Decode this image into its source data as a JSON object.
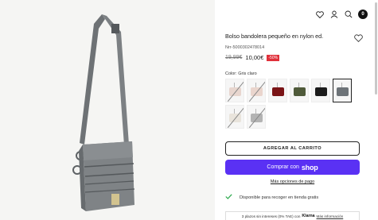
{
  "header": {
    "icons": [
      "heart-icon",
      "user-icon",
      "search-icon",
      "bag-icon"
    ],
    "cart_count": "0"
  },
  "product": {
    "title": "Bolso bandolera pequeño en nylon ed.",
    "sku": "Nrr-5000302478014",
    "old_price": "19,99€",
    "price": "10,00€",
    "discount": "-50%"
  },
  "color": {
    "label": "Color:",
    "value": "Gris claro",
    "swatches": [
      {
        "color": "#e8d6cf",
        "available": false
      },
      {
        "color": "#ead5cd",
        "available": false
      },
      {
        "color": "#7a1416",
        "available": true
      },
      {
        "color": "#4f5a3a",
        "available": true
      },
      {
        "color": "#1b1b1b",
        "available": true
      },
      {
        "color": "#6d7378",
        "available": true,
        "selected": true
      },
      {
        "color": "#e9e4dc",
        "available": false
      },
      {
        "color": "#b3b3b3",
        "available": false
      }
    ]
  },
  "actions": {
    "add_to_cart": "AGREGAR AL CARRITO",
    "buy_with": "Comprar con",
    "buy_brand": "shop",
    "more_options": "Más opciones de pago"
  },
  "availability": {
    "text": "Disponible para recoger en tienda gratis"
  },
  "klarna": {
    "text": "3 plazos sin intereses (0% TAE) con",
    "brand": "Klarna",
    "link": "Más información"
  },
  "colors": {
    "bag_main": "#7f8386",
    "shop_purple": "#5a31f4",
    "discount_red": "#e0303a",
    "check_green": "#2aa84a"
  }
}
